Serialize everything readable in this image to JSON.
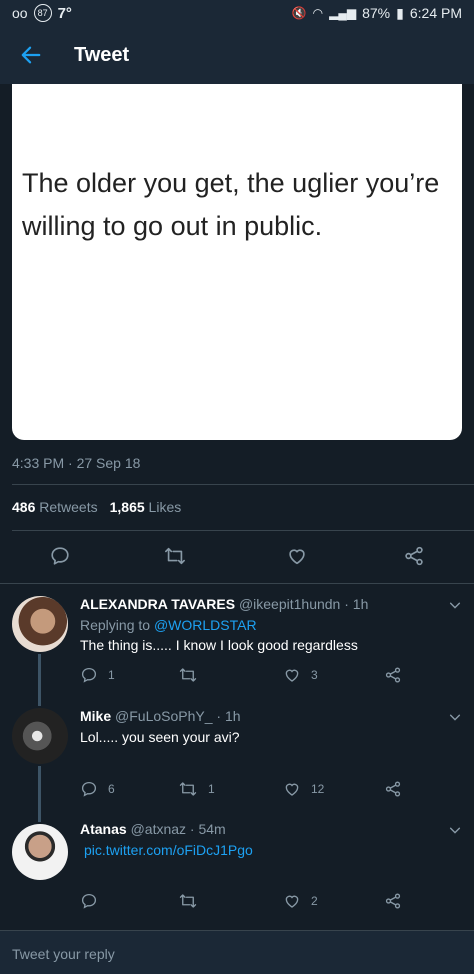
{
  "status_bar": {
    "voicemail": "oo",
    "notif_count": "87",
    "temperature": "7°",
    "battery": "87%",
    "time": "6:24 PM"
  },
  "header": {
    "title": "Tweet"
  },
  "tweet": {
    "image_text_line1": "The older you get, the uglier you’re",
    "image_text_line2": "willing to go out in public.",
    "timestamp": "4:33 PM · 27 Sep 18",
    "retweet_count": "486",
    "retweet_label": "Retweets",
    "like_count": "1,865",
    "like_label": "Likes"
  },
  "replies": [
    {
      "name": "ALEXANDRA TAVARES",
      "meta": "@ikeepit1hundn · 1h",
      "replying_label": "Replying to",
      "replying_handle": "@WORLDSTAR",
      "text": "The thing is..... I know I look good regardless",
      "reply_count": "1",
      "retweet_count": "",
      "like_count": "3"
    },
    {
      "name": "Mike",
      "meta": "@FuLoSoPhY_ · 1h",
      "text": "Lol..... you seen your avi?",
      "reply_count": "6",
      "retweet_count": "1",
      "like_count": "12"
    },
    {
      "name": "Atanas",
      "meta": "@atxnaz · 54m",
      "link": "pic.twitter.com/oFiDcJ1Pgo",
      "reply_count": "",
      "retweet_count": "",
      "like_count": "2"
    }
  ],
  "compose": {
    "placeholder": "Tweet your reply"
  },
  "colors": {
    "background": "#141d26",
    "bar": "#1b2836",
    "accent": "#1da1f2",
    "muted": "#8899a6"
  },
  "icons": [
    "back-arrow-icon",
    "reply-icon",
    "retweet-icon",
    "heart-icon",
    "share-icon",
    "chevron-down-icon"
  ]
}
